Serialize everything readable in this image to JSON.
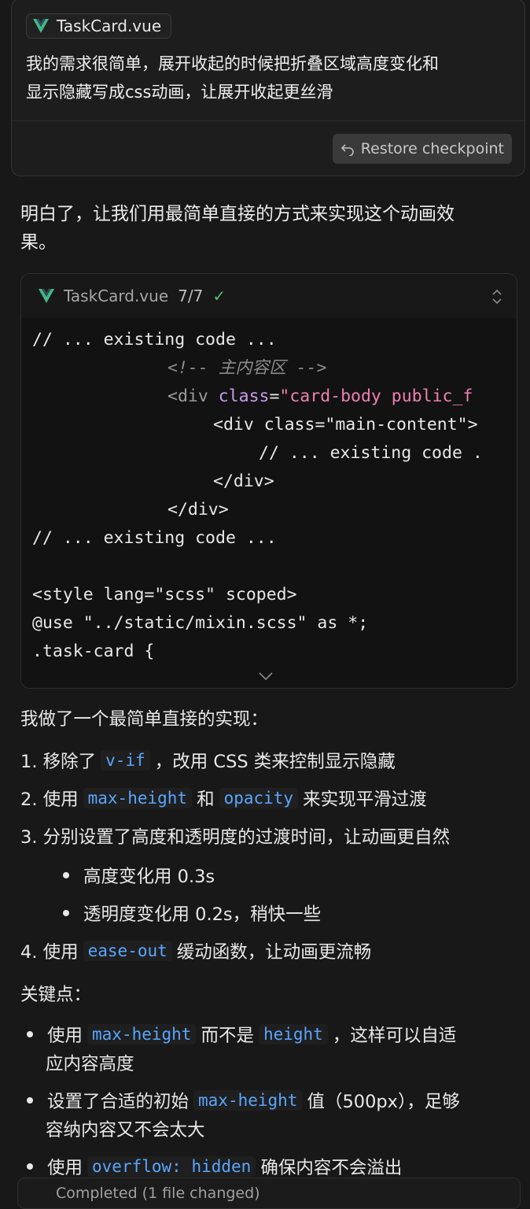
{
  "user_message": {
    "file_chip": "TaskCard.vue",
    "text_line1": "我的需求很简单，展开收起的时候把折叠区域高度变化和",
    "text_line2": "显示隐藏写成css动画，让展开收起更丝滑",
    "restore_label": "Restore checkpoint"
  },
  "reply": {
    "intro_line1": "明白了，让我们用最简单直接的方式来实现这个动画效",
    "intro_line2": "果。",
    "code_block": {
      "file_name": "TaskCard.vue",
      "progress": "7/7",
      "lines": {
        "l1": "// ... existing code ...",
        "l2": "<!-- 主内容区 -->",
        "l3_tag_open": "<div",
        "l3_attr": "class",
        "l3_eq": "=",
        "l3_str": "\"card-body public_f",
        "l4": "<div class=\"main-content\">",
        "l5": "// ... existing code .",
        "l6": "</div>",
        "l7": "</div>",
        "l8": "// ... existing code ...",
        "l9": "<style lang=\"scss\" scoped>",
        "l10": "@use \"../static/mixin.scss\" as *;",
        "l11": ".task-card {"
      }
    },
    "summary_intro": "我做了一个最简单直接的实现：",
    "steps": {
      "s1_a": "1. 移除了",
      "s1_code": "v-if",
      "s1_b": "，改用 CSS 类来控制显示隐藏",
      "s2_a": "2. 使用",
      "s2_code1": "max-height",
      "s2_b": "和",
      "s2_code2": "opacity",
      "s2_c": "来实现平滑过渡",
      "s3": "3. 分别设置了高度和透明度的过渡时间，让动画更自然",
      "s3_sub1": "高度变化用 0.3s",
      "s3_sub2": "透明度变化用 0.2s，稍快一些",
      "s4_a": "4. 使用",
      "s4_code": "ease-out",
      "s4_b": "缓动函数，让动画更流畅"
    },
    "key_points_title": "关键点：",
    "key_points": {
      "k1_a": "使用",
      "k1_code1": "max-height",
      "k1_b": "而不是",
      "k1_code2": "height",
      "k1_c": "，这样可以自适",
      "k1_d": "应内容高度",
      "k2_a": "设置了合适的初始",
      "k2_code": "max-height",
      "k2_b": "值（500px），足够",
      "k2_c": "容纳内容又不会太大",
      "k3_a": "使用",
      "k3_code": "overflow: hidden",
      "k3_b": "确保内容不会溢出"
    },
    "status_bar": "Completed (1 file changed)"
  },
  "colors": {
    "background": "#181818",
    "inline_code": "#58a6ff",
    "vue_green": "#42b883",
    "check_green": "#4fbf6a"
  }
}
